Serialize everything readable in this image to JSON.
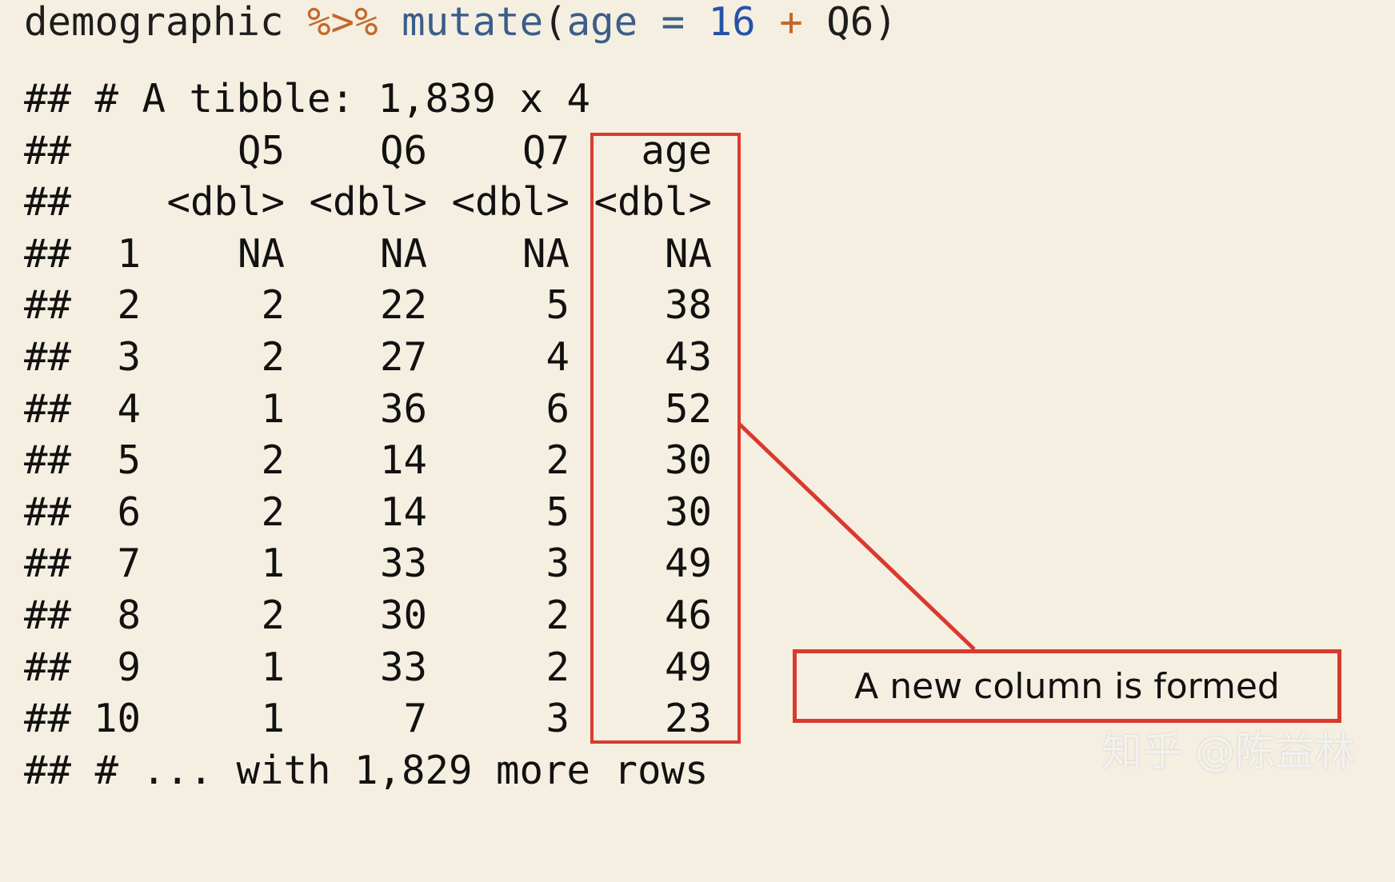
{
  "code": {
    "df": "demographic",
    "pipe": "%>%",
    "func": "mutate",
    "open": "(",
    "arg": "age",
    "eq": "=",
    "num": "16",
    "plus": "+",
    "var": "Q6",
    "close": ")"
  },
  "output": {
    "prefix": "##",
    "header_line": "## # A tibble: 1,839 x 4",
    "columns": [
      "Q5",
      "Q6",
      "Q7",
      "age"
    ],
    "types": [
      "<dbl>",
      "<dbl>",
      "<dbl>",
      "<dbl>"
    ],
    "rows": [
      [
        "1",
        "NA",
        "NA",
        "NA",
        "NA"
      ],
      [
        "2",
        "2",
        "22",
        "5",
        "38"
      ],
      [
        "3",
        "2",
        "27",
        "4",
        "43"
      ],
      [
        "4",
        "1",
        "36",
        "6",
        "52"
      ],
      [
        "5",
        "2",
        "14",
        "2",
        "30"
      ],
      [
        "6",
        "2",
        "14",
        "5",
        "30"
      ],
      [
        "7",
        "1",
        "33",
        "3",
        "49"
      ],
      [
        "8",
        "2",
        "30",
        "2",
        "46"
      ],
      [
        "9",
        "1",
        "33",
        "2",
        "49"
      ],
      [
        "10",
        "1",
        "7",
        "3",
        "23"
      ]
    ],
    "footer_line": "## # ... with 1,829 more rows"
  },
  "annotation": {
    "label": "A new column is formed",
    "color": "#d93a2f"
  },
  "watermark": "知乎 @陈益林"
}
